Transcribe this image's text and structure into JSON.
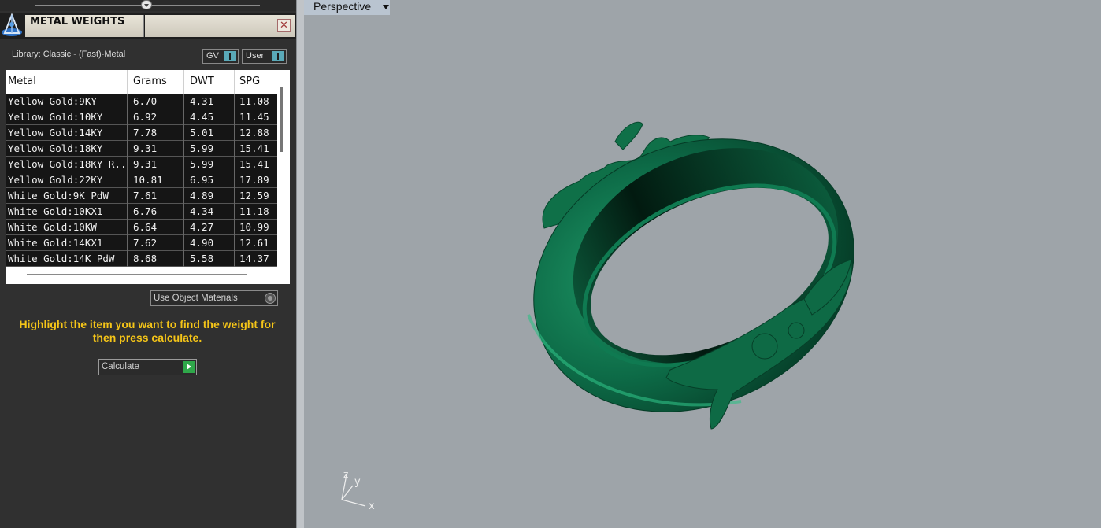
{
  "panel": {
    "title": "METAL WEIGHTS",
    "close_glyph": "✕",
    "library_label": "Library: Classic - (Fast)-Metal",
    "toggles": [
      {
        "label": "GV"
      },
      {
        "label": "User"
      }
    ],
    "table": {
      "headers": [
        "Metal",
        "Grams",
        "DWT",
        "SPG"
      ],
      "rows": [
        [
          "Yellow Gold:9KY",
          "6.70",
          "4.31",
          "11.08"
        ],
        [
          "Yellow Gold:10KY",
          "6.92",
          "4.45",
          "11.45"
        ],
        [
          "Yellow Gold:14KY",
          "7.78",
          "5.01",
          "12.88"
        ],
        [
          "Yellow Gold:18KY",
          "9.31",
          "5.99",
          "15.41"
        ],
        [
          "Yellow Gold:18KY R...",
          "9.31",
          "5.99",
          "15.41"
        ],
        [
          "Yellow Gold:22KY",
          "10.81",
          "6.95",
          "17.89"
        ],
        [
          "White Gold:9K PdW",
          "7.61",
          "4.89",
          "12.59"
        ],
        [
          "White Gold:10KX1",
          "6.76",
          "4.34",
          "11.18"
        ],
        [
          "White Gold:10KW",
          "6.64",
          "4.27",
          "10.99"
        ],
        [
          "White Gold:14KX1",
          "7.62",
          "4.90",
          "12.61"
        ],
        [
          "White Gold:14K PdW",
          "8.68",
          "5.58",
          "14.37"
        ]
      ]
    },
    "use_object_materials_label": "Use Object Materials",
    "instructions": "Highlight the item you want to find the weight for then press calculate.",
    "calculate_label": "Calculate"
  },
  "viewport": {
    "tab_label": "Perspective",
    "axis_labels": {
      "z": "z",
      "y": "y",
      "x": "x"
    }
  },
  "colors": {
    "panel_bg": "#303030",
    "viewport_bg": "#9ea4a9",
    "ring_green": "#0d6b47",
    "instruction_yellow": "#f5c518",
    "toggle_accent": "#5aa9b8",
    "go_green": "#2fa84a"
  }
}
